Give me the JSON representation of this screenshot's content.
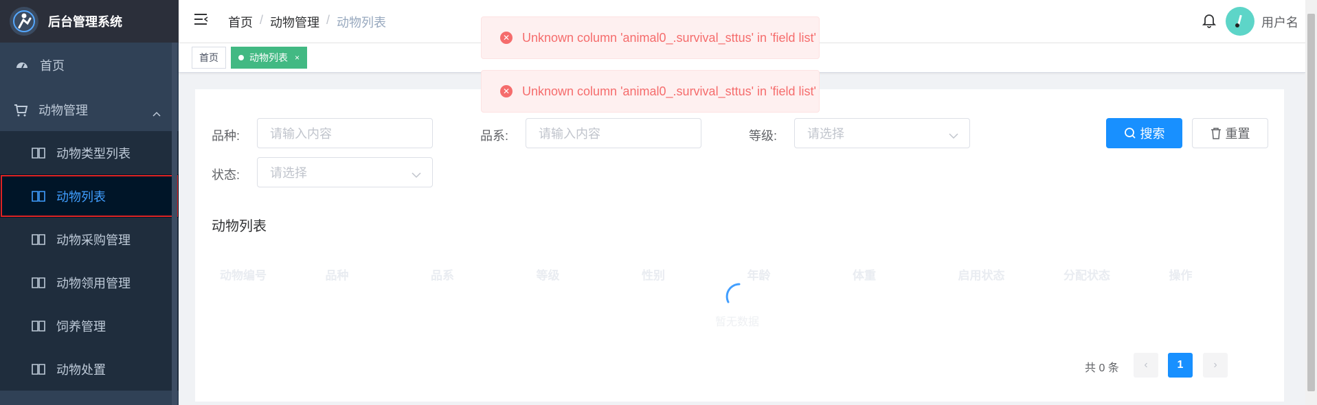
{
  "app": {
    "title": "后台管理系统"
  },
  "sidebar": {
    "home_label": "首页",
    "group_label": "动物管理",
    "items": [
      {
        "label": "动物类型列表"
      },
      {
        "label": "动物列表"
      },
      {
        "label": "动物采购管理"
      },
      {
        "label": "动物领用管理"
      },
      {
        "label": "饲养管理"
      },
      {
        "label": "动物处置"
      }
    ]
  },
  "header": {
    "breadcrumb": [
      "首页",
      "/",
      "动物管理",
      "/",
      "动物列表"
    ],
    "username": "用户名"
  },
  "tags": {
    "home": "首页",
    "active": "动物列表",
    "close": "×"
  },
  "toasts": [
    {
      "message": "Unknown column 'animal0_.survival_sttus' in 'field list'"
    },
    {
      "message": "Unknown column 'animal0_.survival_sttus' in 'field list'"
    }
  ],
  "filters": {
    "breed_label": "品种:",
    "breed_placeholder": "请输入内容",
    "strain_label": "品系:",
    "strain_placeholder": "请输入内容",
    "grade_label": "等级:",
    "grade_placeholder": "请选择",
    "status_label": "状态:",
    "status_placeholder": "请选择",
    "search_label": "搜索",
    "reset_label": "重置"
  },
  "table": {
    "title": "动物列表",
    "columns": [
      "动物编号",
      "品种",
      "品系",
      "等级",
      "性别",
      "年龄",
      "体重",
      "启用状态",
      "分配状态",
      "操作"
    ],
    "empty_text": "暂无数据"
  },
  "pagination": {
    "total_text": "共 0 条",
    "current_page": "1",
    "prev": "‹",
    "next": "›"
  },
  "colors": {
    "sidebar_bg": "#304156",
    "active_menu": "#409eff",
    "primary": "#1890ff",
    "tag_active": "#42b983",
    "error": "#f56c6c"
  }
}
